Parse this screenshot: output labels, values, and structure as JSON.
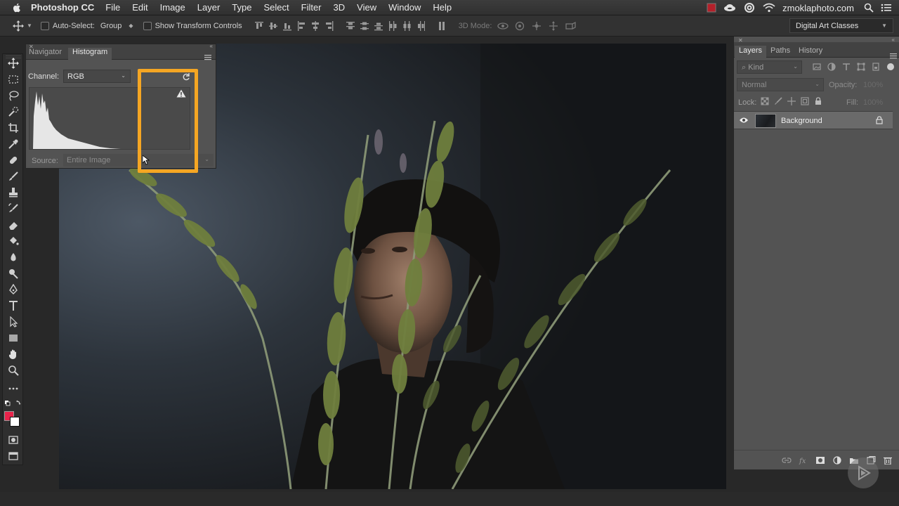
{
  "menubar": {
    "app_name": "Photoshop CC",
    "items": [
      "File",
      "Edit",
      "Image",
      "Layer",
      "Type",
      "Select",
      "Filter",
      "3D",
      "View",
      "Window",
      "Help"
    ],
    "user": "zmoklaphoto.com"
  },
  "options": {
    "auto_select_label": "Auto-Select:",
    "auto_select_value": "Group",
    "transform_label": "Show Transform Controls",
    "mode_3d_label": "3D Mode:",
    "workspace": "Digital Art Classes"
  },
  "histogram": {
    "tabs": [
      "Navigator",
      "Histogram"
    ],
    "active_tab": "Histogram",
    "channel_label": "Channel:",
    "channel_value": "RGB",
    "source_label": "Source:",
    "source_value": "Entire Image"
  },
  "layers": {
    "tabs": [
      "Layers",
      "Paths",
      "History"
    ],
    "kind_placeholder": "Kind",
    "blend_mode": "Normal",
    "opacity_label": "Opacity:",
    "opacity_value": "100%",
    "lock_label": "Lock:",
    "fill_label": "Fill:",
    "fill_value": "100%",
    "layer_items": [
      {
        "name": "Background",
        "locked": true,
        "visible": true
      }
    ]
  },
  "colors": {
    "foreground": "#e8234a",
    "background": "#ffffff",
    "highlight": "#f5a623"
  }
}
